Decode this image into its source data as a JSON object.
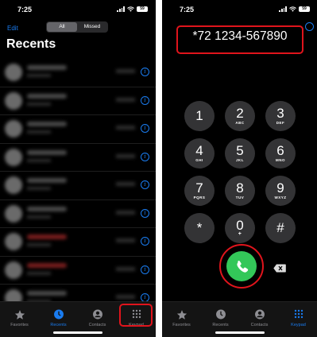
{
  "status": {
    "time": "7:25",
    "battery": "59"
  },
  "recents_screen": {
    "edit_label": "Edit",
    "segment": {
      "all": "All",
      "missed": "Missed"
    },
    "title": "Recents",
    "rows": [
      {
        "missed": false
      },
      {
        "missed": false
      },
      {
        "missed": false
      },
      {
        "missed": false
      },
      {
        "missed": false
      },
      {
        "missed": false
      },
      {
        "missed": true
      },
      {
        "missed": true
      },
      {
        "missed": false
      }
    ]
  },
  "keypad_screen": {
    "number": "*72 1234-567890",
    "keys": [
      {
        "digit": "1",
        "letters": ""
      },
      {
        "digit": "2",
        "letters": "ABC"
      },
      {
        "digit": "3",
        "letters": "DEF"
      },
      {
        "digit": "4",
        "letters": "GHI"
      },
      {
        "digit": "5",
        "letters": "JKL"
      },
      {
        "digit": "6",
        "letters": "MNO"
      },
      {
        "digit": "7",
        "letters": "PQRS"
      },
      {
        "digit": "8",
        "letters": "TUV"
      },
      {
        "digit": "9",
        "letters": "WXYZ"
      },
      {
        "digit": "*",
        "letters": ""
      },
      {
        "digit": "0",
        "letters": "+"
      },
      {
        "digit": "#",
        "letters": ""
      }
    ]
  },
  "tabs": {
    "favorites": "Favorites",
    "recents": "Recents",
    "contacts": "Contacts",
    "keypad": "Keypad"
  },
  "colors": {
    "accent": "#1a7cf0",
    "call_green": "#33c759",
    "highlight": "#e0141c"
  }
}
